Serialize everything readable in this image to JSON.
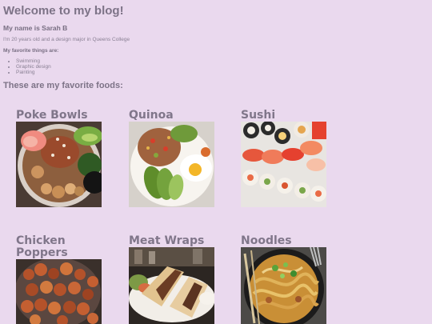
{
  "page": {
    "title": "Welcome to my blog!"
  },
  "intro": {
    "name_line": "My name is Sarah B",
    "bio": "I'm 20 years old and a design major in Queens College"
  },
  "favorites": {
    "heading": "My favorite things are:",
    "items": [
      "Swimming",
      "Graphic design",
      "Painting"
    ]
  },
  "foods": {
    "heading": "These are my favorite foods:",
    "items": [
      {
        "name": "Poke Bowls",
        "image": "poke-bowl-photo"
      },
      {
        "name": "Quinoa",
        "image": "quinoa-bowl-photo"
      },
      {
        "name": "Sushi",
        "image": "sushi-platter-photo"
      },
      {
        "name": "Chicken Poppers",
        "image": "chicken-poppers-photo"
      },
      {
        "name": "Meat Wraps",
        "image": "meat-wraps-photo"
      },
      {
        "name": "Noodles",
        "image": "noodles-photo"
      }
    ]
  }
}
